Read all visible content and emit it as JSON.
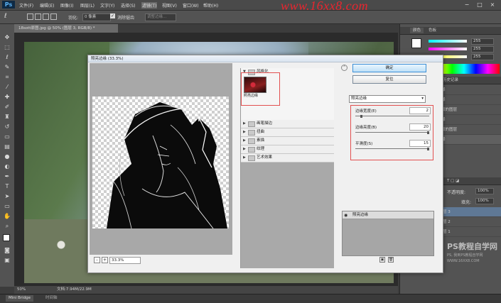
{
  "app": {
    "logo": "Ps"
  },
  "menu": [
    "文件(F)",
    "编辑(E)",
    "图像(I)",
    "图层(L)",
    "文字(Y)",
    "选择(S)",
    "滤镜(T)",
    "视图(V)",
    "窗口(W)",
    "帮助(H)"
  ],
  "watermark": "www.16xx8.com",
  "options_bar": {
    "feather_label": "羽化:",
    "feather_value": "0 像素",
    "antialias": "消除锯齿",
    "refine_edge": "调整边缘..."
  },
  "document": {
    "tab_title": "18sott原图.jpg @ 50% (图层 3, RGB/8) *",
    "zoom": "50%",
    "doc_info": "文档:7.94M/22.9M"
  },
  "bottom_tabs": {
    "mini_bridge": "Mini Bridge",
    "timeline": "时间轴"
  },
  "panels": {
    "color_tab": "颜色",
    "swatches_tab": "色板",
    "rgb": [
      {
        "channel": "R",
        "value": "255"
      },
      {
        "channel": "G",
        "value": "255"
      },
      {
        "channel": "B",
        "value": "255"
      }
    ],
    "history_tab": "历史记录",
    "history_items": [
      "择",
      "择",
      "取的图层",
      "择",
      "取的图层",
      "择"
    ],
    "opacity_label": "不透明度:",
    "opacity_value": "100%",
    "fill_label": "填充:",
    "fill_value": "100%",
    "layers": [
      "层 3",
      "层 2",
      "层 1"
    ]
  },
  "dialog": {
    "title": "照亮边缘 (33.3%)",
    "zoom_value": "33.3%",
    "zoom_minus": "-",
    "zoom_plus": "+",
    "open_folder": "风格化",
    "thumb_label": "照亮边缘",
    "folders": [
      "画笔描边",
      "扭曲",
      "素描",
      "纹理",
      "艺术效果"
    ],
    "ok_label": "确定",
    "reset_label": "复位",
    "filter_select": "照亮边缘",
    "params": [
      {
        "label": "边缘宽度(E)",
        "value": "2",
        "fraction": 0.07
      },
      {
        "label": "边缘亮度(B)",
        "value": "20",
        "fraction": 1.0
      },
      {
        "label": "平滑度(S)",
        "value": "15",
        "fraction": 1.0
      }
    ],
    "effect_layer": "照亮边缘"
  },
  "site_watermark": {
    "line1": "PS教程自学网",
    "line2": "PS, 我到PS教程自学网",
    "line3": "WWW.16XX8.COM"
  }
}
